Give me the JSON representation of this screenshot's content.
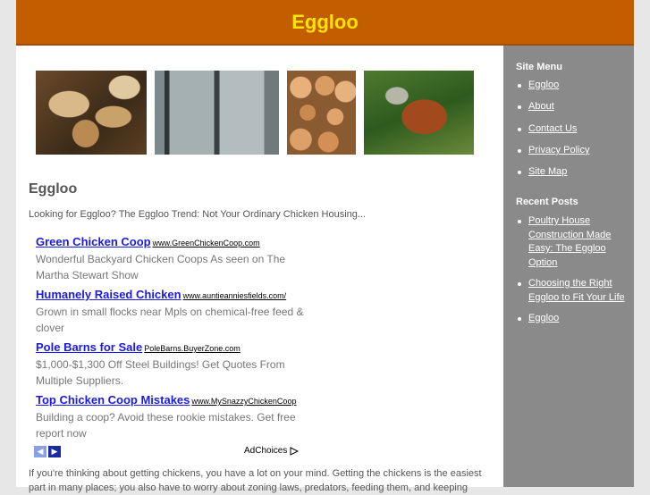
{
  "site_title": "Eggloo",
  "post": {
    "title": "Eggloo",
    "intro": "Looking for Eggloo? The Eggloo Trend: Not Your Ordinary Chicken Housing...",
    "body_line1": "If you're thinking about getting chickens, you have a lot on your mind. Getting the chickens is the easiest",
    "body_line2": "part in many places; you also have to worry about zoning laws, predators, feeding them, and keeping"
  },
  "ads": [
    {
      "title": "Green Chicken Coop",
      "url": "www.GreenChickenCoop.com",
      "desc": "Wonderful Backyard Chicken Coops As seen on The Martha Stewart Show"
    },
    {
      "title": "Humanely Raised Chicken",
      "url": "www.auntieanniesfields.com/",
      "desc": "Grown in small flocks near Mpls on chemical-free feed & clover"
    },
    {
      "title": "Pole Barns for Sale",
      "url": "PoleBarns.BuyerZone.com",
      "desc": "$1,000-$1,300 Off Steel Buildings! Get Quotes From Multiple Suppliers."
    },
    {
      "title": "Top Chicken Coop Mistakes",
      "url": "www.MySnazzyChickenCoop",
      "desc": "Building a coop? Avoid these rookie mistakes. Get free report now"
    }
  ],
  "ad_nav": {
    "prev_icon": "chevron-left-icon",
    "next_icon": "chevron-right-icon",
    "adchoices_label": "AdChoices"
  },
  "sidebar": {
    "menu_heading": "Site Menu",
    "menu": [
      "Eggloo",
      "About",
      "Contact Us",
      "Privacy Policy",
      "Site Map"
    ],
    "recent_heading": "Recent Posts",
    "recent": [
      "Poultry House Construction Made Easy: The Eggloo Option",
      "Choosing the Right Eggloo to Fit Your Life",
      "Eggloo"
    ]
  },
  "colors": {
    "header_bg": "#c25e00",
    "header_title": "#ffe400",
    "sidebar_bg": "#8a8a8a",
    "ad_link": "#1a1ae6"
  }
}
